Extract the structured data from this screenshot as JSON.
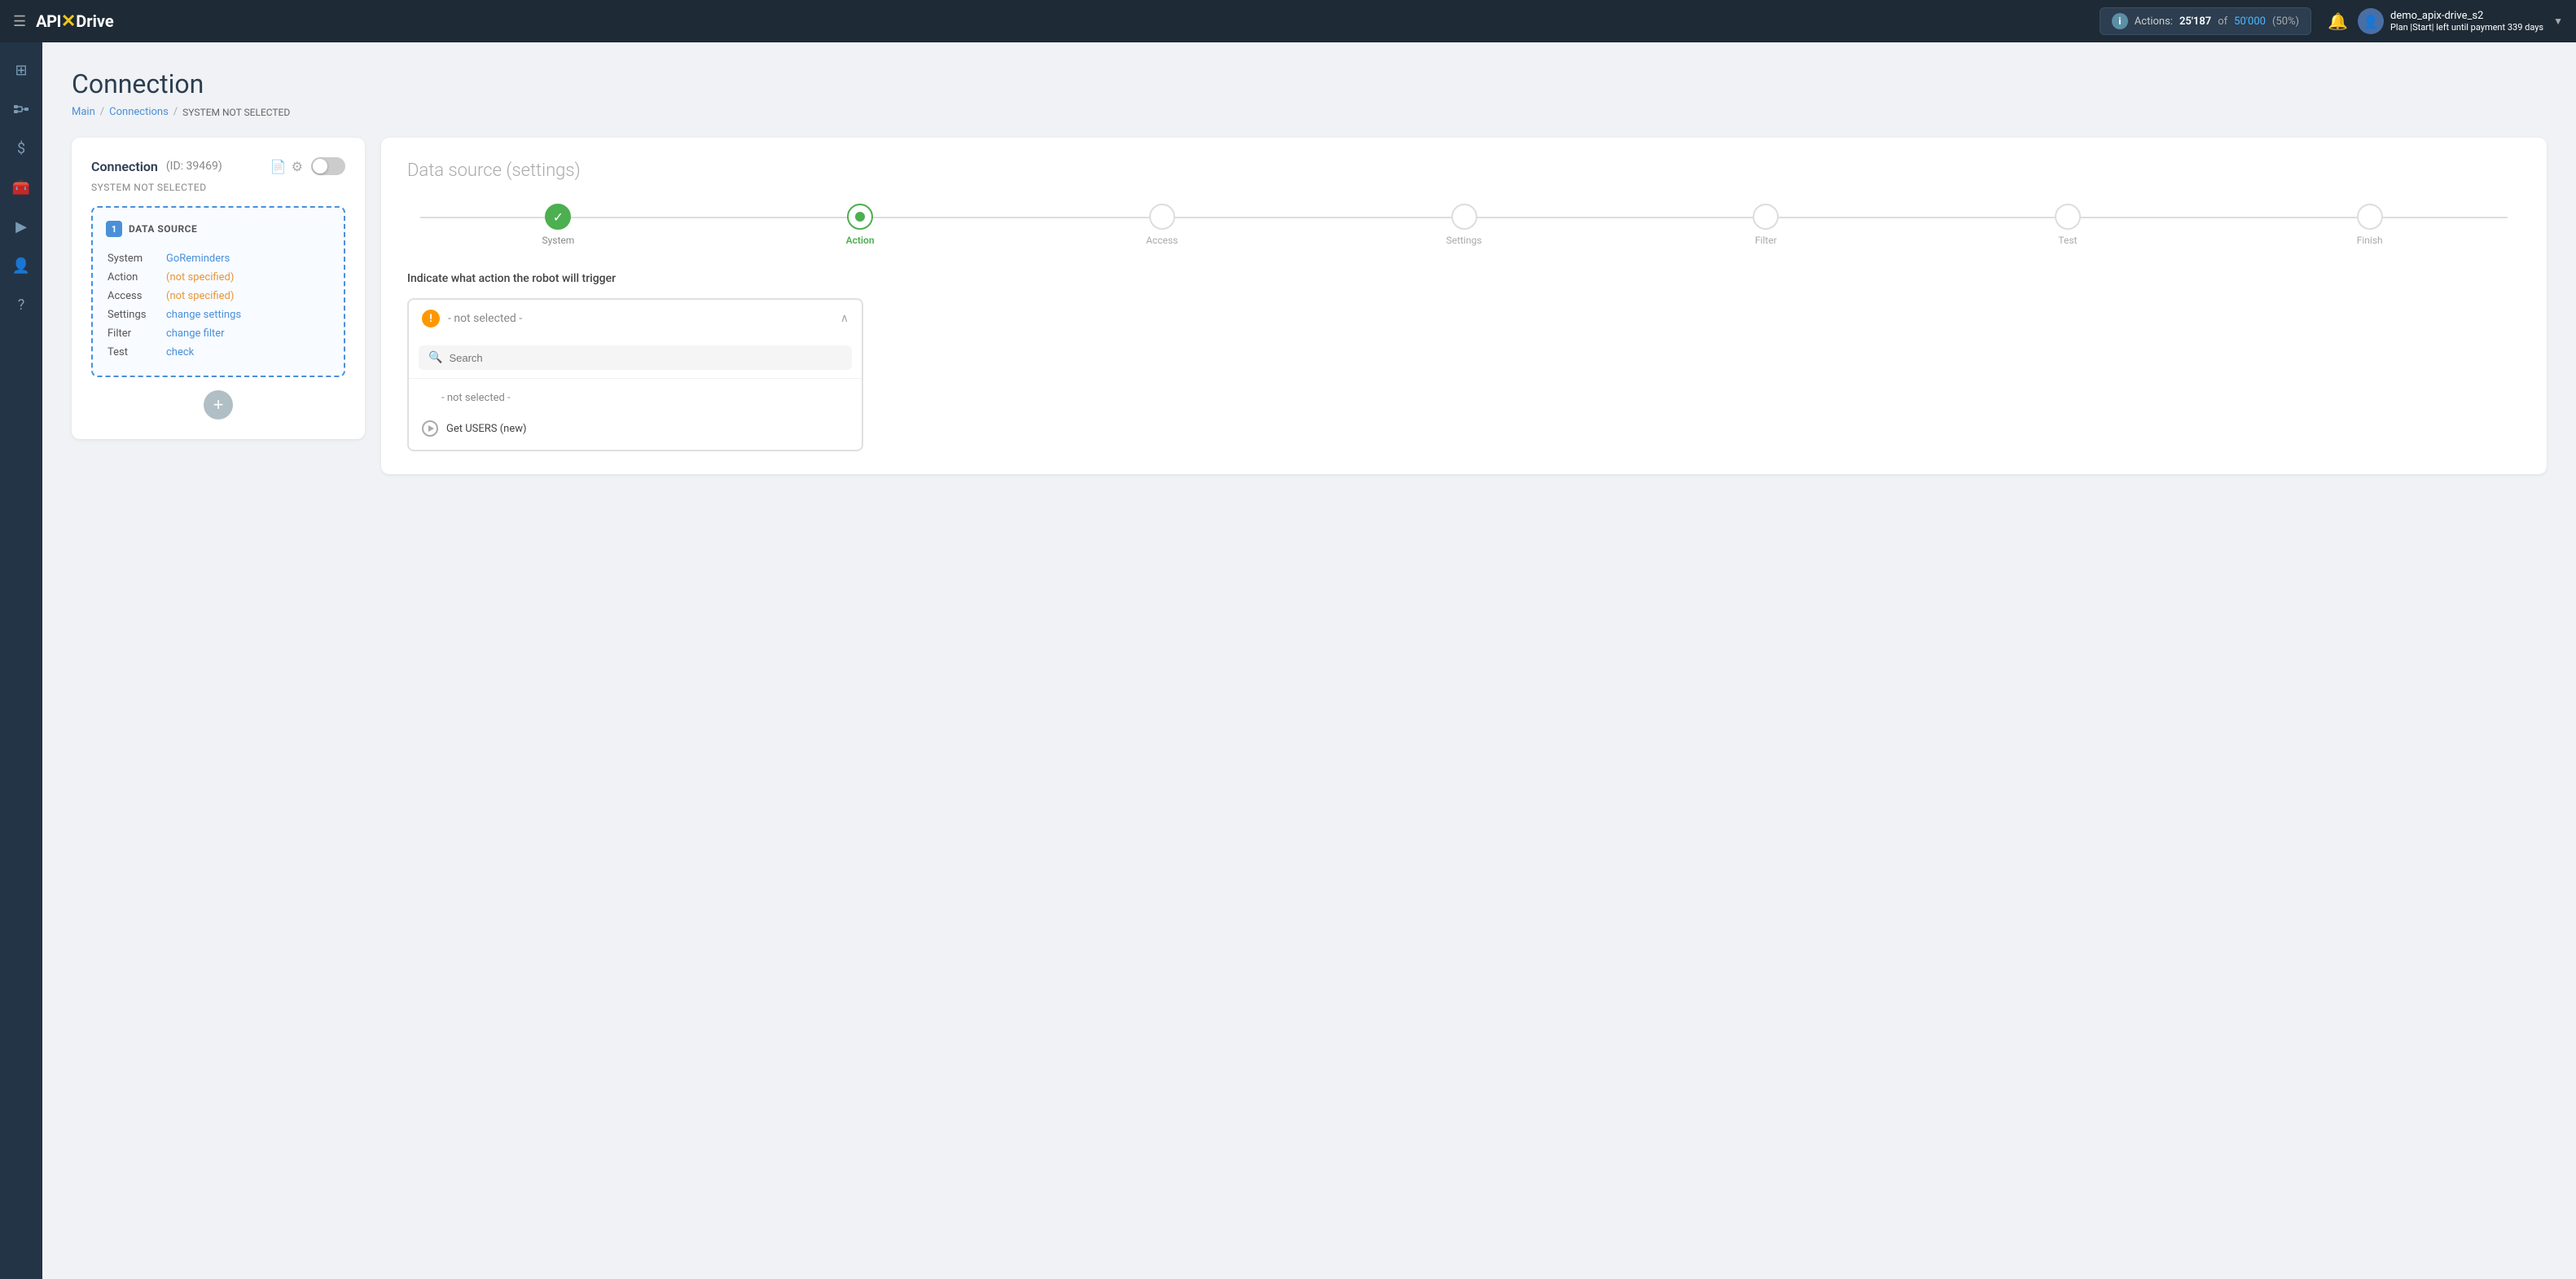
{
  "topnav": {
    "menu_label": "☰",
    "logo_api": "API",
    "logo_x": "✕",
    "logo_drive": "Drive",
    "actions_label": "Actions:",
    "actions_count": "25'187",
    "actions_of": " of ",
    "actions_total": "50'000",
    "actions_pct": "(50%)",
    "bell_label": "🔔",
    "user_avatar_icon": "👤",
    "user_name": "demo_apix-drive_s2",
    "user_plan_text": "Plan |Start| left until payment",
    "user_days": "339 days",
    "chevron": "▼"
  },
  "sidebar": {
    "items": [
      {
        "icon": "⊞",
        "name": "dashboard"
      },
      {
        "icon": "⋮⋮",
        "name": "connections"
      },
      {
        "icon": "$",
        "name": "billing"
      },
      {
        "icon": "🧰",
        "name": "tools"
      },
      {
        "icon": "▶",
        "name": "play"
      },
      {
        "icon": "👤",
        "name": "account"
      },
      {
        "icon": "?",
        "name": "help"
      }
    ]
  },
  "page": {
    "title": "Connection",
    "breadcrumb_main": "Main",
    "breadcrumb_connections": "Connections",
    "breadcrumb_current": "SYSTEM NOT SELECTED"
  },
  "left_card": {
    "title": "Connection",
    "id_label": "(ID: 39469)",
    "copy_icon": "📄",
    "settings_icon": "⚙",
    "system_not_selected": "SYSTEM NOT SELECTED",
    "ds_number": "1",
    "ds_label": "DATA SOURCE",
    "rows": [
      {
        "label": "System",
        "value": "GoReminders",
        "type": "link"
      },
      {
        "label": "Action",
        "value": "(not specified)",
        "type": "orange-link"
      },
      {
        "label": "Access",
        "value": "(not specified)",
        "type": "orange-link"
      },
      {
        "label": "Settings",
        "value": "change settings",
        "type": "link"
      },
      {
        "label": "Filter",
        "value": "change filter",
        "type": "link"
      },
      {
        "label": "Test",
        "value": "check",
        "type": "link"
      }
    ],
    "add_btn_label": "+"
  },
  "right_card": {
    "title": "Data source",
    "subtitle": "(settings)",
    "steps": [
      {
        "label": "System",
        "state": "done"
      },
      {
        "label": "Action",
        "state": "active"
      },
      {
        "label": "Access",
        "state": "pending"
      },
      {
        "label": "Settings",
        "state": "pending"
      },
      {
        "label": "Filter",
        "state": "pending"
      },
      {
        "label": "Test",
        "state": "pending"
      },
      {
        "label": "Finish",
        "state": "pending"
      }
    ],
    "instruction": "Indicate what action the robot will trigger",
    "dropdown_value": "- not selected -",
    "search_placeholder": "Search",
    "options": [
      {
        "type": "not-selected",
        "label": "- not selected -"
      },
      {
        "type": "play",
        "label": "Get USERS (new)"
      }
    ]
  }
}
